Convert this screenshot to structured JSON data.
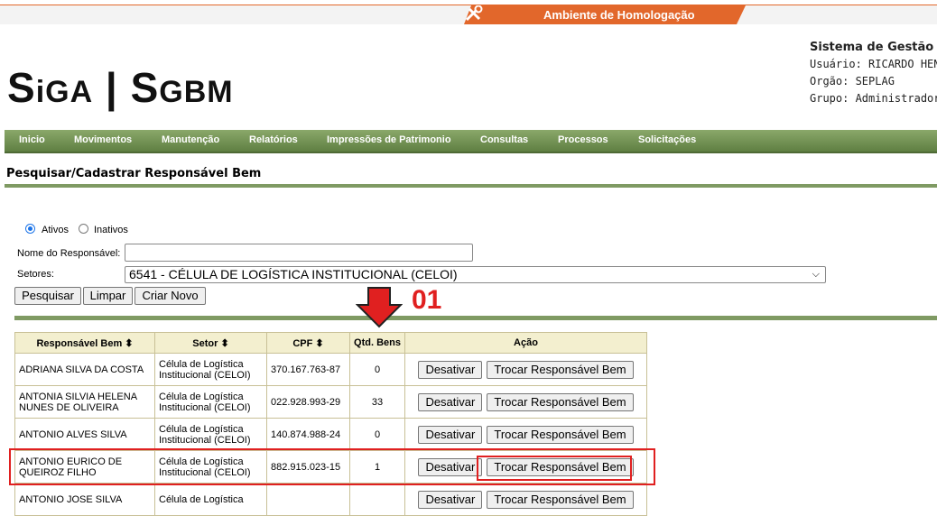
{
  "env": {
    "label": "Ambiente de Homologação",
    "icon": "tools-icon"
  },
  "header": {
    "logo_parts": [
      "S",
      "i",
      "GA",
      " | ",
      "S",
      "GBM"
    ],
    "system_title": "Sistema de Gestão de",
    "user": "Usuário: RICARDO HEN",
    "org": "Orgão: SEPLAG",
    "group": "Grupo: Administrador"
  },
  "menu": [
    "Inicio",
    "Movimentos",
    "Manutenção",
    "Relatórios",
    "Impressões de Patrimonio",
    "Consultas",
    "Processos",
    "Solicitações"
  ],
  "page_title": "Pesquisar/Cadastrar Responsável Bem",
  "form": {
    "radio_active": "Ativos",
    "radio_inactive": "Inativos",
    "name_label": "Nome do Responsável:",
    "name_value": "",
    "sector_label": "Setores:",
    "sector_value": "6541 - CÉLULA DE LOGÍSTICA INSTITUCIONAL (CELOI)",
    "btn_search": "Pesquisar",
    "btn_clear": "Limpar",
    "btn_new": "Criar Novo"
  },
  "annotation": {
    "number": "01"
  },
  "table": {
    "headers": [
      "Responsável Bem ⬍",
      "Setor ⬍",
      "CPF ⬍",
      "Qtd. Bens",
      "Ação"
    ],
    "deactivate_label": "Desativar",
    "swap_label": "Trocar Responsável Bem",
    "rows": [
      {
        "name": "ADRIANA SILVA DA COSTA",
        "sector": "Célula de Logística Institucional (CELOI)",
        "cpf": "370.167.763-87",
        "qty": "0"
      },
      {
        "name": "ANTONIA SILVIA HELENA NUNES DE OLIVEIRA",
        "sector": "Célula de Logística Institucional (CELOI)",
        "cpf": "022.928.993-29",
        "qty": "33"
      },
      {
        "name": "ANTONIO ALVES SILVA",
        "sector": "Célula de Logística Institucional (CELOI)",
        "cpf": "140.874.988-24",
        "qty": "0"
      },
      {
        "name": "ANTONIO EURICO DE QUEIROZ FILHO",
        "sector": "Célula de Logística Institucional (CELOI)",
        "cpf": "882.915.023-15",
        "qty": "1"
      },
      {
        "name": "ANTONIO JOSE SILVA",
        "sector": "Célula de Logística",
        "cpf": "",
        "qty": ""
      }
    ]
  },
  "colors": {
    "menu_green": "#6b8a4c",
    "env_orange": "#e2672b",
    "highlight_red": "#e02020"
  }
}
